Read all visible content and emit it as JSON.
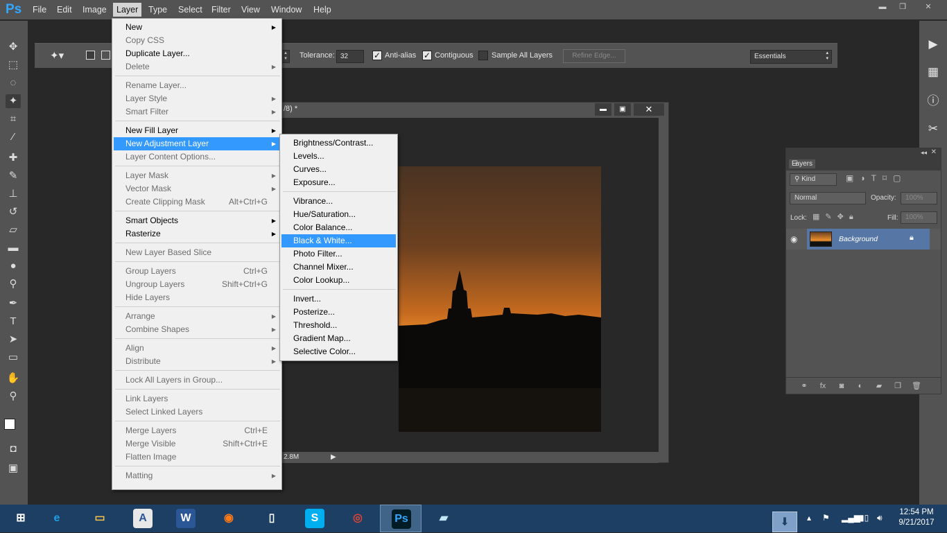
{
  "app": {
    "logo": "Ps"
  },
  "menubar": {
    "items": [
      "File",
      "Edit",
      "Image",
      "Layer",
      "Type",
      "Select",
      "Filter",
      "View",
      "Window",
      "Help"
    ],
    "active": "Layer"
  },
  "window_controls": {
    "minimize": "▬",
    "restore": "❐",
    "close": "✕"
  },
  "options_bar": {
    "tolerance_label": "Tolerance:",
    "tolerance_value": "32",
    "anti_alias": {
      "label": "Anti-alias",
      "checked": true
    },
    "contiguous": {
      "label": "Contiguous",
      "checked": true
    },
    "sample_all_layers": {
      "label": "Sample All Layers",
      "checked": false
    },
    "refine_edge": "Refine Edge...",
    "workspace": "Essentials"
  },
  "document": {
    "title_fragment": "/8) *",
    "status": "2.8M"
  },
  "layers_panel": {
    "tab": "Layers",
    "filter": "Kind",
    "blend_mode": "Normal",
    "opacity_label": "Opacity:",
    "opacity_value": "100%",
    "lock_label": "Lock:",
    "fill_label": "Fill:",
    "fill_value": "100%",
    "layer_name": "Background"
  },
  "layer_menu": [
    {
      "label": "New",
      "submenu": true
    },
    {
      "label": "Copy CSS",
      "disabled": true
    },
    {
      "label": "Duplicate Layer..."
    },
    {
      "label": "Delete",
      "submenu": true,
      "disabled": true
    },
    {
      "sep": true
    },
    {
      "label": "Rename Layer...",
      "disabled": true
    },
    {
      "label": "Layer Style",
      "submenu": true,
      "disabled": true
    },
    {
      "label": "Smart Filter",
      "submenu": true,
      "disabled": true
    },
    {
      "sep": true
    },
    {
      "label": "New Fill Layer",
      "submenu": true
    },
    {
      "label": "New Adjustment Layer",
      "submenu": true,
      "highlighted": true
    },
    {
      "label": "Layer Content Options...",
      "disabled": true
    },
    {
      "sep": true
    },
    {
      "label": "Layer Mask",
      "submenu": true,
      "disabled": true
    },
    {
      "label": "Vector Mask",
      "submenu": true,
      "disabled": true
    },
    {
      "label": "Create Clipping Mask",
      "shortcut": "Alt+Ctrl+G",
      "disabled": true
    },
    {
      "sep": true
    },
    {
      "label": "Smart Objects",
      "submenu": true
    },
    {
      "label": "Rasterize",
      "submenu": true
    },
    {
      "sep": true
    },
    {
      "label": "New Layer Based Slice",
      "disabled": true
    },
    {
      "sep": true
    },
    {
      "label": "Group Layers",
      "shortcut": "Ctrl+G",
      "disabled": true
    },
    {
      "label": "Ungroup Layers",
      "shortcut": "Shift+Ctrl+G",
      "disabled": true
    },
    {
      "label": "Hide Layers",
      "disabled": true
    },
    {
      "sep": true
    },
    {
      "label": "Arrange",
      "submenu": true,
      "disabled": true
    },
    {
      "label": "Combine Shapes",
      "submenu": true,
      "disabled": true
    },
    {
      "sep": true
    },
    {
      "label": "Align",
      "submenu": true,
      "disabled": true
    },
    {
      "label": "Distribute",
      "submenu": true,
      "disabled": true
    },
    {
      "sep": true
    },
    {
      "label": "Lock All Layers in Group...",
      "disabled": true
    },
    {
      "sep": true
    },
    {
      "label": "Link Layers",
      "disabled": true
    },
    {
      "label": "Select Linked Layers",
      "disabled": true
    },
    {
      "sep": true
    },
    {
      "label": "Merge Layers",
      "shortcut": "Ctrl+E",
      "disabled": true
    },
    {
      "label": "Merge Visible",
      "shortcut": "Shift+Ctrl+E",
      "disabled": true
    },
    {
      "label": "Flatten Image",
      "disabled": true
    },
    {
      "sep": true
    },
    {
      "label": "Matting",
      "submenu": true,
      "disabled": true
    }
  ],
  "adjustment_submenu": [
    {
      "label": "Brightness/Contrast..."
    },
    {
      "label": "Levels..."
    },
    {
      "label": "Curves..."
    },
    {
      "label": "Exposure..."
    },
    {
      "sep": true
    },
    {
      "label": "Vibrance..."
    },
    {
      "label": "Hue/Saturation..."
    },
    {
      "label": "Color Balance..."
    },
    {
      "label": "Black & White...",
      "highlighted": true
    },
    {
      "label": "Photo Filter..."
    },
    {
      "label": "Channel Mixer..."
    },
    {
      "label": "Color Lookup..."
    },
    {
      "sep": true
    },
    {
      "label": "Invert..."
    },
    {
      "label": "Posterize..."
    },
    {
      "label": "Threshold..."
    },
    {
      "label": "Gradient Map..."
    },
    {
      "label": "Selective Color..."
    }
  ],
  "taskbar": {
    "apps": [
      {
        "name": "start-button",
        "glyph": "⊞",
        "color": "#ffffff",
        "bg": "transparent"
      },
      {
        "name": "internet-explorer",
        "glyph": "e",
        "color": "#1ea0e6",
        "bg": "transparent"
      },
      {
        "name": "file-explorer",
        "glyph": "▭",
        "color": "#f3c24b",
        "bg": "transparent"
      },
      {
        "name": "wordpad",
        "glyph": "A",
        "color": "#2b5797",
        "bg": "#e8e8e8"
      },
      {
        "name": "word",
        "glyph": "W",
        "color": "#ffffff",
        "bg": "#2b5797"
      },
      {
        "name": "firefox",
        "glyph": "◉",
        "color": "#ff7a18",
        "bg": "transparent"
      },
      {
        "name": "notepad",
        "glyph": "▯",
        "color": "#ffffff",
        "bg": "transparent"
      },
      {
        "name": "skype",
        "glyph": "S",
        "color": "#ffffff",
        "bg": "#00aff0"
      },
      {
        "name": "chrome",
        "glyph": "◎",
        "color": "#db4437",
        "bg": "transparent"
      },
      {
        "name": "photoshop",
        "glyph": "Ps",
        "color": "#31a8ff",
        "bg": "#001d26",
        "active": true
      },
      {
        "name": "notes",
        "glyph": "▰",
        "color": "#bfe6f5",
        "bg": "transparent"
      }
    ],
    "time": "12:54 PM",
    "date": "9/21/2017"
  }
}
